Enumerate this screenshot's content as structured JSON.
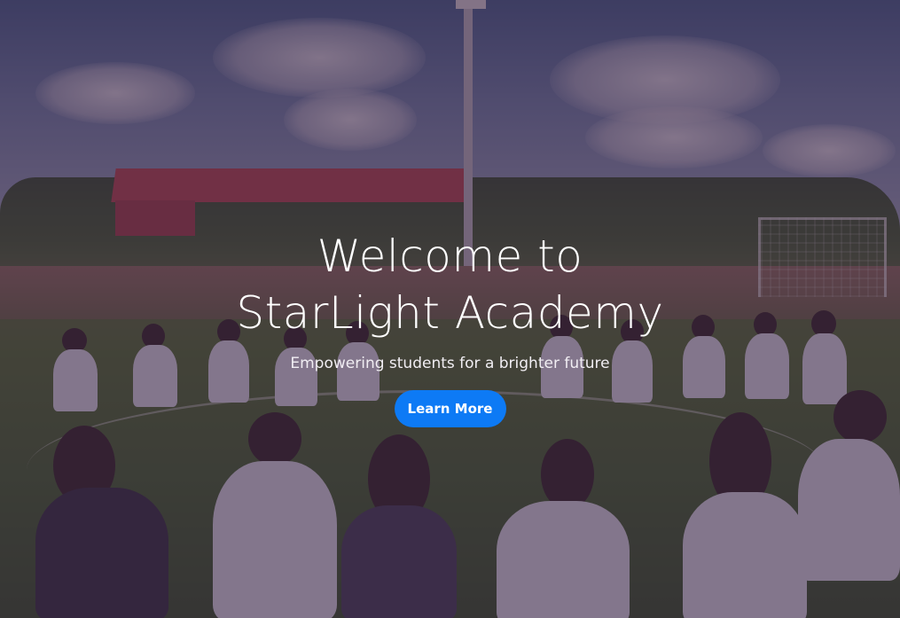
{
  "hero": {
    "title_line1": "Welcome to",
    "title_line2": "StarLight Academy",
    "subtitle": "Empowering students for a brighter future",
    "cta_label": "Learn More"
  },
  "colors": {
    "overlay": "#3c2341",
    "cta": "#0d7af5",
    "text": "#ffffff"
  },
  "background": {
    "image_subject": "students-sitting-in-circle-on-field-photo"
  }
}
